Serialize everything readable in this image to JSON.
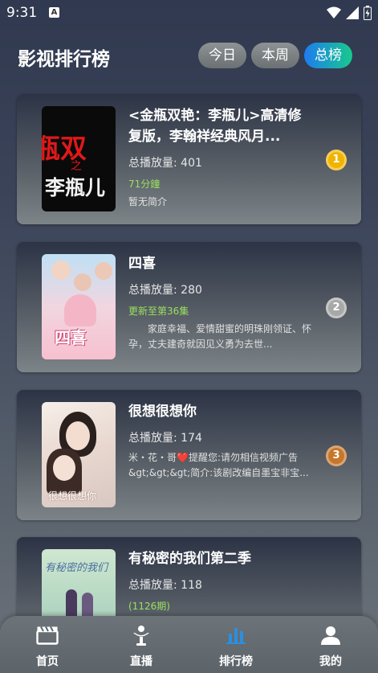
{
  "status_bar": {
    "time": "9:31",
    "notification_letter": "A"
  },
  "header": {
    "title": "影视排行榜",
    "tabs": [
      {
        "label": "今日",
        "active": false
      },
      {
        "label": "本周",
        "active": false
      },
      {
        "label": "总榜",
        "active": true
      }
    ]
  },
  "cards": [
    {
      "title": "<金瓶双艳：李瓶儿>高清修复版，李翰祥经典风月...",
      "plays": "总播放量: 401",
      "status": "71分鐘",
      "desc": "暂无简介",
      "rank": "1",
      "rank_color": "#f0b400",
      "poster_text_1": "瓶双",
      "poster_text_2": "之",
      "poster_text_3": "李瓶儿"
    },
    {
      "title": "四喜",
      "plays": "总播放量: 280",
      "status": "更新至第36集",
      "desc": "　　家庭幸福、爱情甜蜜的明珠刚领证、怀孕，丈夫建奇就因见义勇为去世...",
      "rank": "2",
      "rank_color": "#a8a8a8",
      "poster_text_1": "四喜"
    },
    {
      "title": "很想很想你",
      "plays": "总播放量: 174",
      "status": "",
      "desc": "米・花・哥❤️提醒您:请勿相信视频广告&gt;&gt;&gt;简介:该剧改编自墨宝非宝...",
      "rank": "3",
      "rank_color": "#c7762a",
      "poster_text_1": "很想很想你"
    },
    {
      "title": "有秘密的我们第二季",
      "plays": "总播放量: 118",
      "status": "(1126期)",
      "desc": "",
      "rank": "",
      "rank_color": "",
      "poster_text_1": "有秘密的我们"
    }
  ],
  "bottom_nav": [
    {
      "label": "首页",
      "icon": "clapperboard-icon",
      "active": false
    },
    {
      "label": "直播",
      "icon": "trophy-icon",
      "active": false
    },
    {
      "label": "排行榜",
      "icon": "bar-chart-icon",
      "active": true
    },
    {
      "label": "我的",
      "icon": "person-icon",
      "active": false
    }
  ]
}
